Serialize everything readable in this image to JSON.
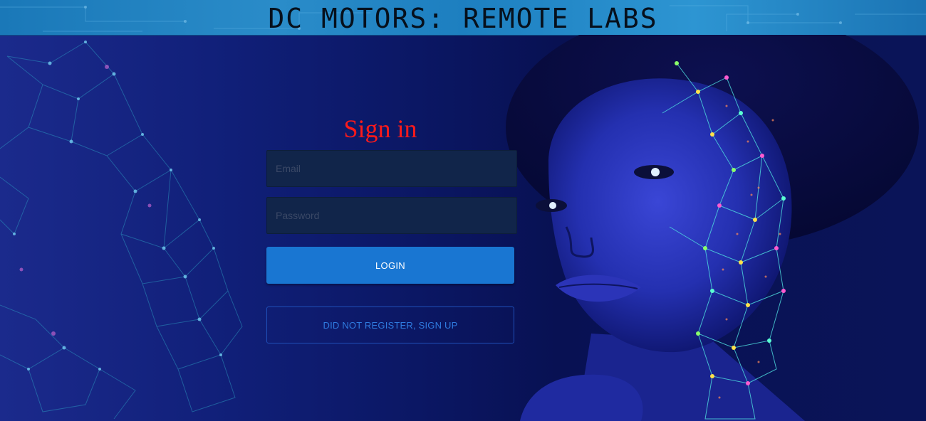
{
  "header": {
    "title": "DC MOTORS: REMOTE LABS"
  },
  "signin": {
    "heading": "Sign in",
    "email_placeholder": "Email",
    "password_placeholder": "Password",
    "login_label": "LOGIN",
    "signup_label": "DID NOT REGISTER, SIGN UP"
  },
  "colors": {
    "heading": "#ff1a1a",
    "login_button": "#1976d2",
    "signup_border": "#1f4fb8",
    "header_bar": "#2a8cc9"
  },
  "images": {
    "left_background": "network-mesh-illustration",
    "right_background": "woman-portrait-with-glowing-network"
  }
}
